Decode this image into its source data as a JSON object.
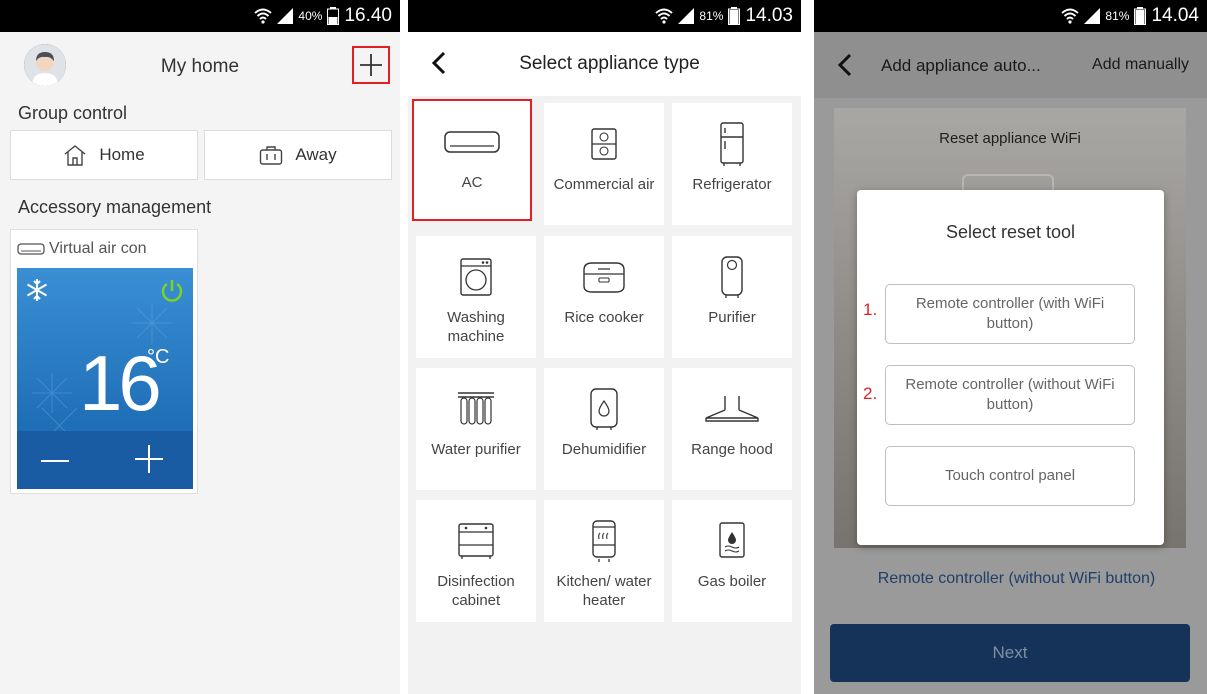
{
  "panel1": {
    "status": {
      "battery": "40%",
      "time": "16.40"
    },
    "title": "My home",
    "group_label": "Group control",
    "home_label": "Home",
    "away_label": "Away",
    "accessory_label": "Accessory management",
    "accessory_name": "Virtual air con",
    "temperature": "16",
    "temp_unit": "°C"
  },
  "panel2": {
    "status": {
      "battery": "81%",
      "time": "14.03"
    },
    "title": "Select appliance type",
    "tiles": [
      {
        "label": "AC",
        "icon": "ac-icon"
      },
      {
        "label": "Commercial air",
        "icon": "commercial-air-icon"
      },
      {
        "label": "Refrigerator",
        "icon": "refrigerator-icon"
      },
      {
        "label": "Washing machine",
        "icon": "washing-machine-icon"
      },
      {
        "label": "Rice cooker",
        "icon": "rice-cooker-icon"
      },
      {
        "label": "Purifier",
        "icon": "purifier-icon"
      },
      {
        "label": "Water purifier",
        "icon": "water-purifier-icon"
      },
      {
        "label": "Dehumidifier",
        "icon": "dehumidifier-icon"
      },
      {
        "label": "Range hood",
        "icon": "range-hood-icon"
      },
      {
        "label": "Disinfection cabinet",
        "icon": "disinfection-cabinet-icon"
      },
      {
        "label": "Kitchen/ water heater",
        "icon": "kitchen-water-heater-icon"
      },
      {
        "label": "Gas boiler",
        "icon": "gas-boiler-icon"
      }
    ]
  },
  "panel3": {
    "status": {
      "battery": "81%",
      "time": "14.04"
    },
    "title": "Add appliance auto...",
    "manual_label": "Add manually",
    "image_title": "Reset appliance WiFi",
    "modal_title": "Select reset tool",
    "options": [
      {
        "label": "Remote controller (with WiFi button)",
        "mark": "1."
      },
      {
        "label": "Remote controller (without WiFi button)",
        "mark": "2."
      },
      {
        "label": "Touch control panel",
        "mark": ""
      }
    ],
    "selected_link": "Remote controller (without WiFi button)",
    "next_label": "Next"
  },
  "colors": {
    "highlight": "#e31e24",
    "power_green": "#7ed321",
    "next_bg": "#153259"
  }
}
